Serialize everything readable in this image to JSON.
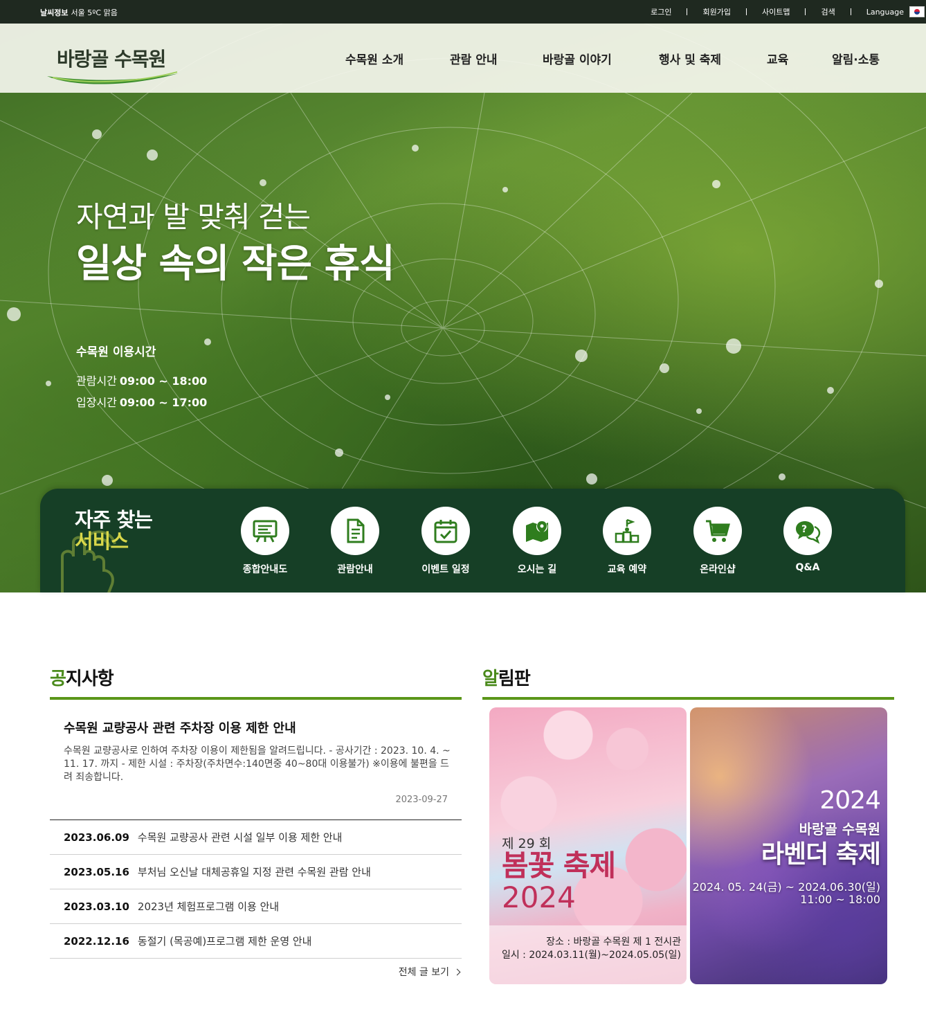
{
  "topbar": {
    "weather_label": "날씨정보",
    "weather_value": "서울 5ºC 맑음",
    "links": [
      "로그인",
      "회원가입",
      "사이트맵",
      "검색",
      "Language"
    ],
    "flag_icon": "korea-flag-icon"
  },
  "header": {
    "logo": "바랑골 수목원",
    "nav": [
      "수목원 소개",
      "관람 안내",
      "바랑골 이야기",
      "행사 및 축제",
      "교육",
      "알림·소통"
    ]
  },
  "hero": {
    "subtitle": "자연과 발 맞춰 걷는",
    "title": "일상 속의 작은 휴식",
    "hours_title": "수목원 이용시간",
    "viewing_label": "관람시간",
    "viewing_time": "09:00 ~ 18:00",
    "entry_label": "입장시간",
    "entry_time": "09:00 ~ 17:00"
  },
  "quick": {
    "title_line1": "자주 찾는",
    "title_line2": "서비스",
    "accent_color": "#d9d84a",
    "services": [
      {
        "label": "종합안내도",
        "icon": "map-board-icon"
      },
      {
        "label": "관람안내",
        "icon": "document-icon"
      },
      {
        "label": "이벤트 일정",
        "icon": "calendar-check-icon"
      },
      {
        "label": "오시는 길",
        "icon": "map-pin-icon"
      },
      {
        "label": "교육 예약",
        "icon": "education-icon"
      },
      {
        "label": "온라인샵",
        "icon": "cart-icon"
      },
      {
        "label": "Q&A",
        "icon": "qna-icon"
      }
    ]
  },
  "notice": {
    "title_first": "공",
    "title_rest": "지사항",
    "featured": {
      "title": "수목원 교량공사 관련 주차장 이용 제한 안내",
      "body": "수목원 교량공사로 인하여 주차장 이용이 제한됨을 알려드립니다. - 공사기간 : 2023. 10. 4. ~ 11. 17. 까지 - 제한 시설 : 주차장(주차면수:140면중 40~80대 이용불가) ※이용에 불편을 드려 죄송합니다.",
      "date": "2023-09-27"
    },
    "rows": [
      {
        "date": "2023.06.09",
        "title": "수목원 교량공사 관련 시설 일부 이용 제한 안내"
      },
      {
        "date": "2023.05.16",
        "title": "부처님 오신날 대체공휴일 지정 관련 수목원 관람 안내"
      },
      {
        "date": "2023.03.10",
        "title": "2023년 체험프로그램 이용 안내"
      },
      {
        "date": "2022.12.16",
        "title": "동절기 (목공예)프로그램 제한 운영 안내"
      }
    ],
    "more": "전체 글 보기"
  },
  "board": {
    "title_first": "알",
    "title_rest": "림판",
    "posters": [
      {
        "round": "제 29 회",
        "title": "봄꽃 축제",
        "year": "2024",
        "place": "장소 : 바랑골 수목원 제 1 전시관",
        "date": "일시 : 2024.03.11(월)~2024.05.05(일)"
      },
      {
        "year": "2024",
        "sub": "바랑골 수목원",
        "title": "라벤더 축제",
        "date": "2024. 05. 24(금) ~ 2024.06.30(일)",
        "time": "11:00 ~ 18:00"
      }
    ]
  },
  "colors": {
    "topbar": "#1f2920",
    "quick_bg": "#163f26",
    "accent_green": "#5a9619",
    "festival_pink": "#c0305a"
  }
}
